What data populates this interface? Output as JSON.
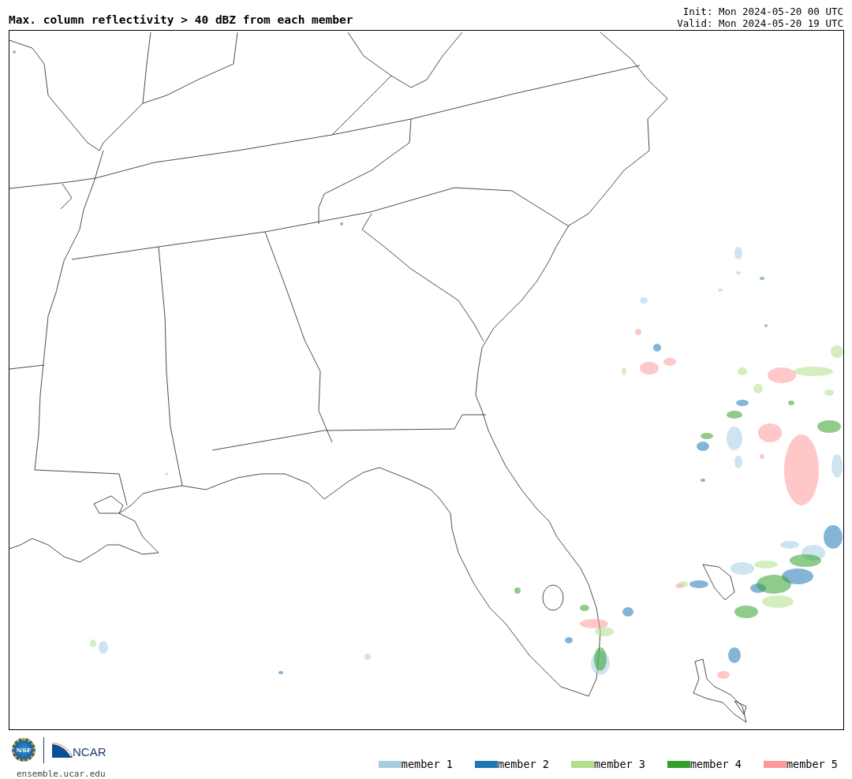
{
  "title": "Max. column reflectivity > 40 dBZ from each member",
  "init": "Init: Mon 2024-05-20 00 UTC",
  "valid": "Valid: Mon 2024-05-20 19 UTC",
  "footer": {
    "nsf_logo_text": "NSF",
    "ncar_logo_text": "NCAR",
    "url": "ensemble.ucar.edu"
  },
  "legend": [
    {
      "label": "member 1",
      "color": "#a6cee3"
    },
    {
      "label": "member 2",
      "color": "#1f78b4"
    },
    {
      "label": "member 3",
      "color": "#b2df8a"
    },
    {
      "label": "member 4",
      "color": "#33a02c"
    },
    {
      "label": "member 5",
      "color": "#fb9a99"
    }
  ]
}
